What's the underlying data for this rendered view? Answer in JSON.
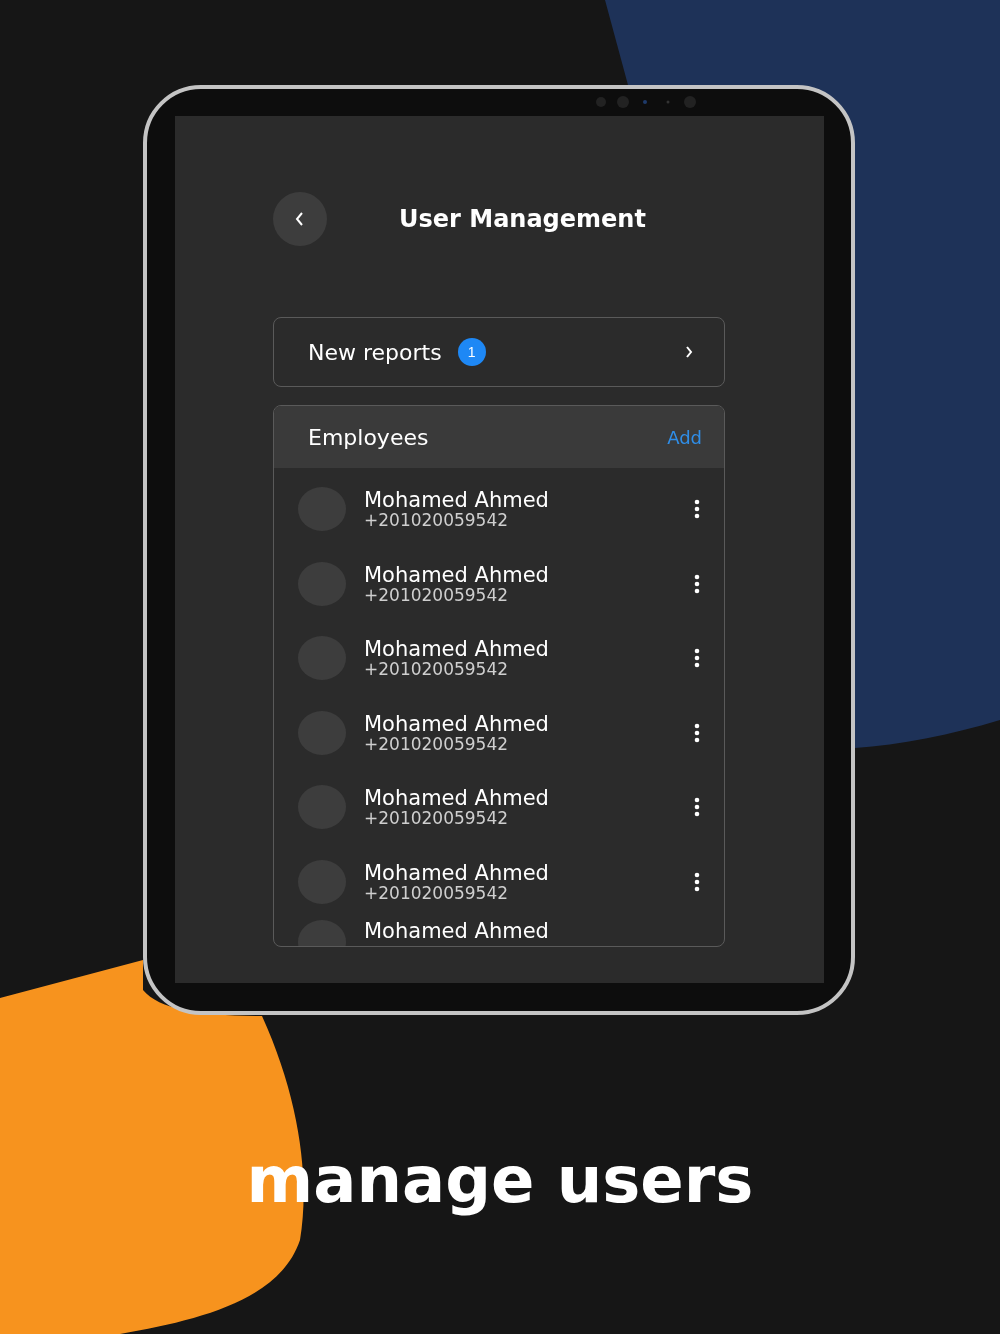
{
  "screen": {
    "title": "User Management",
    "reports": {
      "label": "New reports",
      "badge": "1"
    },
    "employees": {
      "title": "Employees",
      "action": "Add",
      "rows": [
        {
          "name": "Mohamed Ahmed",
          "phone": "+201020059542"
        },
        {
          "name": "Mohamed Ahmed",
          "phone": "+201020059542"
        },
        {
          "name": "Mohamed Ahmed",
          "phone": "+201020059542"
        },
        {
          "name": "Mohamed Ahmed",
          "phone": "+201020059542"
        },
        {
          "name": "Mohamed Ahmed",
          "phone": "+201020059542"
        },
        {
          "name": "Mohamed Ahmed",
          "phone": "+201020059542"
        },
        {
          "name": "Mohamed Ahmed"
        }
      ]
    }
  },
  "caption": "manage users"
}
